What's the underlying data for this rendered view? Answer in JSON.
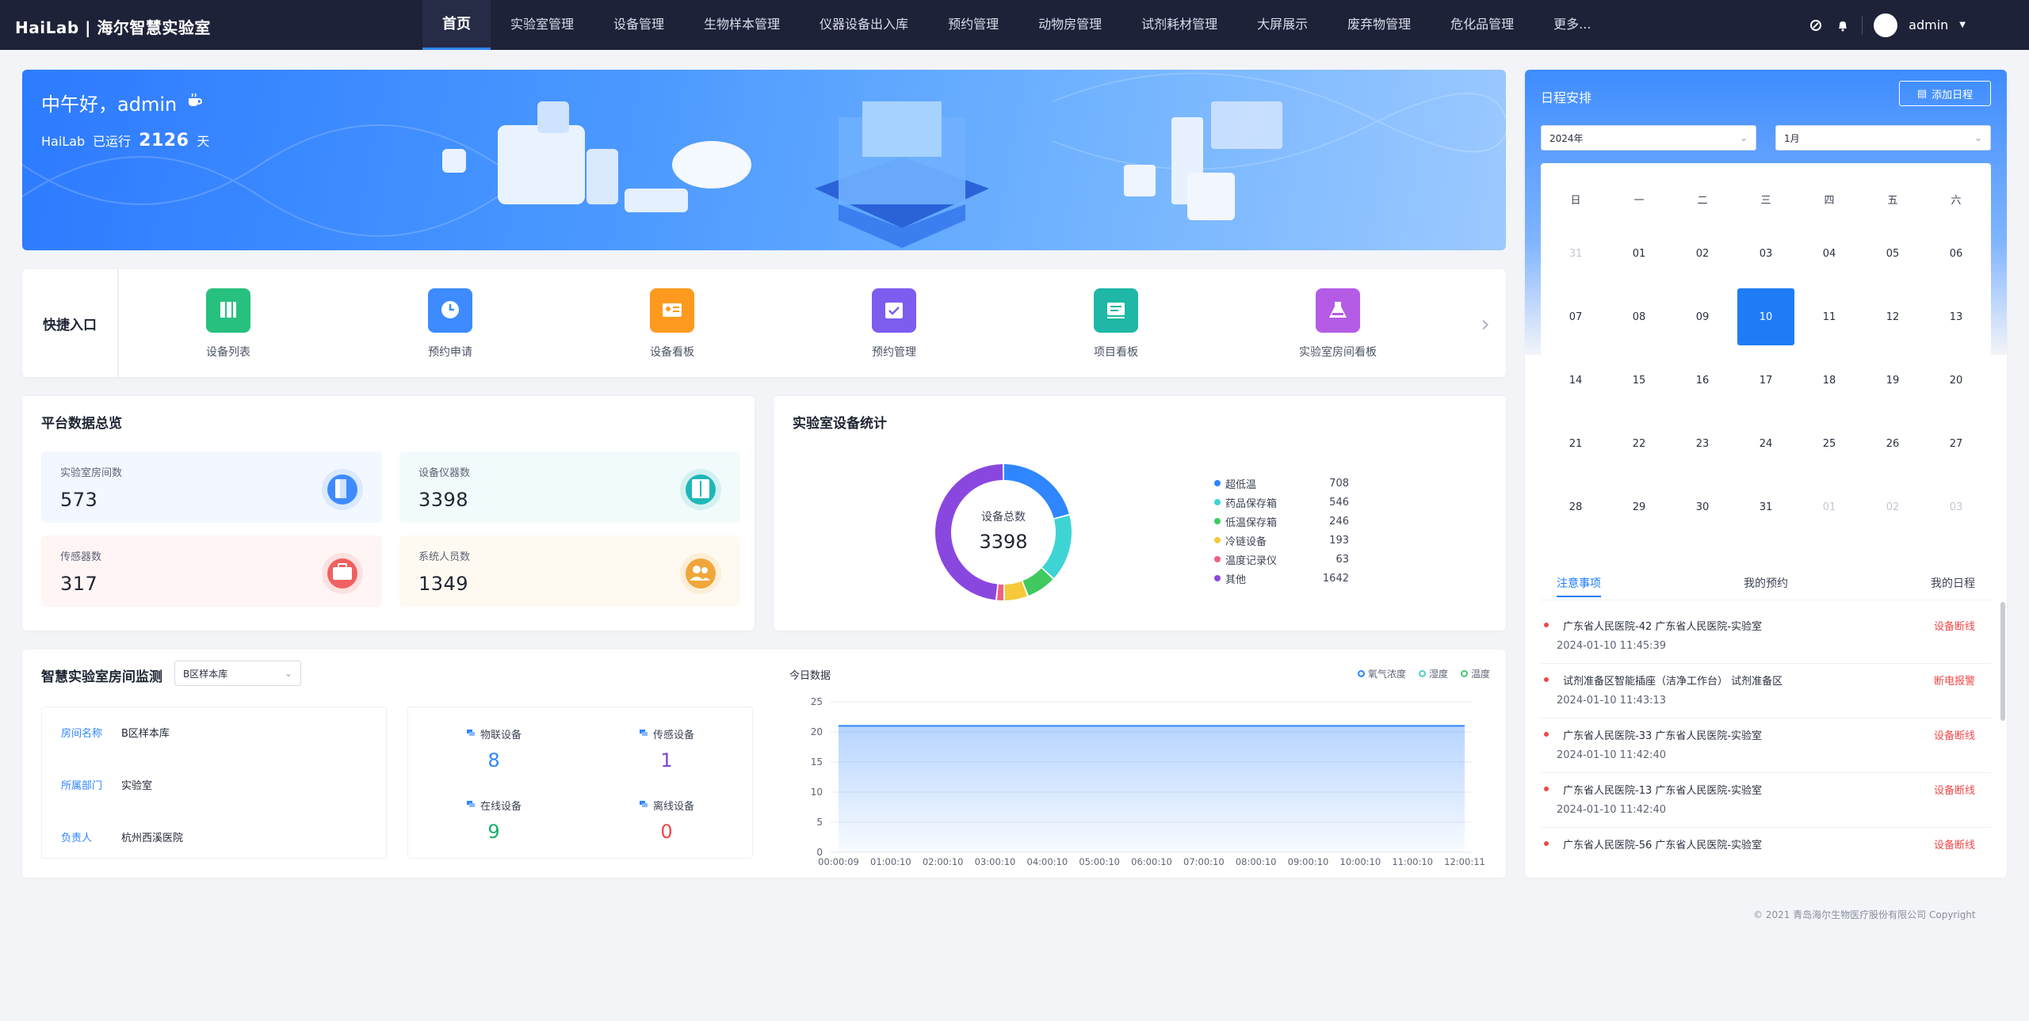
{
  "brand": "HaiLab | 海尔智慧实验室",
  "nav": [
    "首页",
    "实验室管理",
    "设备管理",
    "生物样本管理",
    "仪器设备出入库",
    "预约管理",
    "动物房管理",
    "试剂耗材管理",
    "大屏展示",
    "废弃物管理",
    "危化品管理",
    "更多..."
  ],
  "user": {
    "name": "admin",
    "icons": [
      "link-icon",
      "bell-icon",
      "chevron-down-icon"
    ]
  },
  "banner": {
    "greeting": "中午好，admin",
    "product": "HaiLab",
    "running_label": "已运行",
    "days": "2126",
    "days_unit": "天"
  },
  "quick": {
    "label": "快捷入口",
    "items": [
      {
        "label": "设备列表",
        "icon": "device-list-icon",
        "color": "#27c07e"
      },
      {
        "label": "预约申请",
        "icon": "clock-icon",
        "color": "#3d8bff"
      },
      {
        "label": "设备看板",
        "icon": "board-card-icon",
        "color": "#ff9a1f"
      },
      {
        "label": "预约管理",
        "icon": "calendar-check-icon",
        "color": "#7d5cf0"
      },
      {
        "label": "项目看板",
        "icon": "project-board-icon",
        "color": "#1fb7a6"
      },
      {
        "label": "实验室房间看板",
        "icon": "flask-icon",
        "color": "#b45be6"
      }
    ]
  },
  "overview": {
    "title": "平台数据总览",
    "stats": [
      {
        "label": "实验室房间数",
        "value": "573",
        "icon": "door-icon",
        "color": "#3d8bff"
      },
      {
        "label": "设备仪器数",
        "value": "3398",
        "icon": "cabinet-icon",
        "color": "#20b7b7"
      },
      {
        "label": "传感器数",
        "value": "317",
        "icon": "toolbox-icon",
        "color": "#f06060"
      },
      {
        "label": "系统人员数",
        "value": "1349",
        "icon": "users-icon",
        "color": "#f0a63a"
      }
    ]
  },
  "devstat": {
    "title": "实验室设备统计",
    "center_label": "设备总数",
    "center_value": "3398"
  },
  "monitor": {
    "title": "智慧实验室房间监测",
    "select": "B区样本库",
    "info": [
      {
        "key": "房间名称",
        "value": "B区样本库"
      },
      {
        "key": "所属部门",
        "value": "实验室"
      },
      {
        "key": "负责人",
        "value": "杭州西溪医院"
      }
    ],
    "counts": [
      {
        "label": "物联设备",
        "value": "8",
        "color": "#2f86ff"
      },
      {
        "label": "传感设备",
        "value": "1",
        "color": "#7d45d8"
      },
      {
        "label": "在线设备",
        "value": "9",
        "color": "#16b06a"
      },
      {
        "label": "离线设备",
        "value": "0",
        "color": "#f04848"
      }
    ]
  },
  "chart_data": {
    "type": "area",
    "title": "今日数据",
    "series": [
      {
        "name": "氧气浓度",
        "values": [
          21,
          21,
          21,
          21,
          21,
          21,
          21,
          21,
          21,
          21,
          21,
          21,
          21
        ]
      }
    ],
    "legend": [
      "氧气浓度",
      "湿度",
      "温度"
    ],
    "legend_colors": [
      "#2f86ff",
      "#4fd1c5",
      "#48c774"
    ],
    "x": [
      "00:00:09",
      "01:00:10",
      "02:00:10",
      "03:00:10",
      "04:00:10",
      "05:00:10",
      "06:00:10",
      "07:00:10",
      "08:00:10",
      "09:00:10",
      "10:00:10",
      "11:00:10",
      "12:00:11"
    ],
    "yticks": [
      "0",
      "5",
      "10",
      "15",
      "20",
      "25"
    ],
    "ylim": [
      0,
      25
    ],
    "grid": true,
    "legend_position": "top-right"
  },
  "donut_data": {
    "type": "pie",
    "categories": [
      "超低温",
      "药品保存箱",
      "低温保存箱",
      "冷链设备",
      "温度记录仪",
      "其他"
    ],
    "values": [
      708,
      546,
      246,
      193,
      63,
      1642
    ],
    "colors": [
      "#2f86ff",
      "#3ed4d4",
      "#3fc95f",
      "#f5c93a",
      "#f06080",
      "#8a47e0"
    ]
  },
  "schedule": {
    "title": "日程安排",
    "add_button": "添加日程",
    "year": "2024年",
    "month": "1月",
    "weekdays": [
      "日",
      "一",
      "二",
      "三",
      "四",
      "五",
      "六"
    ],
    "days": [
      {
        "d": "31",
        "dim": true
      },
      {
        "d": "01"
      },
      {
        "d": "02"
      },
      {
        "d": "03"
      },
      {
        "d": "04"
      },
      {
        "d": "05"
      },
      {
        "d": "06"
      },
      {
        "d": "07"
      },
      {
        "d": "08"
      },
      {
        "d": "09"
      },
      {
        "d": "10",
        "today": true
      },
      {
        "d": "11"
      },
      {
        "d": "12"
      },
      {
        "d": "13"
      },
      {
        "d": "14"
      },
      {
        "d": "15"
      },
      {
        "d": "16"
      },
      {
        "d": "17"
      },
      {
        "d": "18"
      },
      {
        "d": "19"
      },
      {
        "d": "20"
      },
      {
        "d": "21"
      },
      {
        "d": "22"
      },
      {
        "d": "23"
      },
      {
        "d": "24"
      },
      {
        "d": "25"
      },
      {
        "d": "26"
      },
      {
        "d": "27"
      },
      {
        "d": "28"
      },
      {
        "d": "29"
      },
      {
        "d": "30"
      },
      {
        "d": "31"
      },
      {
        "d": "01",
        "dim": true
      },
      {
        "d": "02",
        "dim": true
      },
      {
        "d": "03",
        "dim": true
      }
    ],
    "tabs": [
      "注意事项",
      "我的预约",
      "我的日程"
    ],
    "notices": [
      {
        "title": "广东省人民医院-42  广东省人民医院-实验室",
        "date": "2024-01-10 11:45:39",
        "status": "设备断线"
      },
      {
        "title": "试剂准备区智能插座（洁净工作台）  试剂准备区",
        "date": "2024-01-10 11:43:13",
        "status": "断电报警"
      },
      {
        "title": "广东省人民医院-33  广东省人民医院-实验室",
        "date": "2024-01-10 11:42:40",
        "status": "设备断线"
      },
      {
        "title": "广东省人民医院-13  广东省人民医院-实验室",
        "date": "2024-01-10 11:42:40",
        "status": "设备断线"
      },
      {
        "title": "广东省人民医院-56  广东省人民医院-实验室",
        "date": "",
        "status": "设备断线"
      }
    ]
  },
  "footer": "© 2021 青岛海尔生物医疗股份有限公司 Copyright"
}
